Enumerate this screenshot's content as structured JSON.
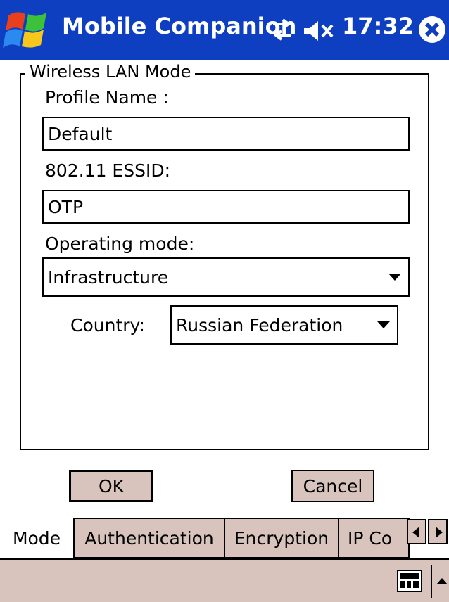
{
  "titlebar": {
    "title": "Mobile Companion",
    "time": "17:32",
    "icons": [
      "windows-start-icon",
      "connectivity-icon",
      "volume-muted-icon",
      "close-icon"
    ],
    "background": "#0d3fc0"
  },
  "group": {
    "legend": "Wireless LAN Mode",
    "profile_label": "Profile Name :",
    "profile_value": "Default",
    "essid_label": "802.11 ESSID:",
    "essid_value": "OTP",
    "mode_label": "Operating mode:",
    "mode_value": "Infrastructure",
    "country_label": "Country:",
    "country_value": "Russian Federation"
  },
  "buttons": {
    "ok": "OK",
    "cancel": "Cancel"
  },
  "tabs": [
    {
      "label": "Mode",
      "active": true
    },
    {
      "label": "Authentication",
      "active": false
    },
    {
      "label": "Encryption",
      "active": false
    },
    {
      "label": "IP Co",
      "active": false
    }
  ],
  "colors": {
    "titlebar": "#0d3fc0",
    "button_face": "#d8c4bc"
  }
}
